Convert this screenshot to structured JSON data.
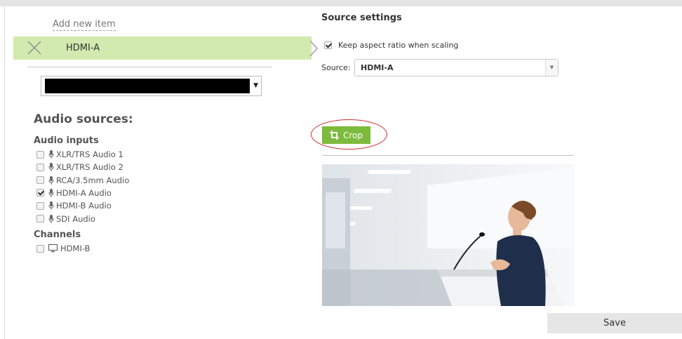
{
  "left": {
    "add_item": "Add new item",
    "selected_item": "HDMI-A",
    "audio_heading": "Audio sources:",
    "audio_inputs_heading": "Audio inputs",
    "audio_inputs": [
      {
        "label": "XLR/TRS Audio 1",
        "checked": false
      },
      {
        "label": "XLR/TRS Audio 2",
        "checked": false
      },
      {
        "label": "RCA/3.5mm Audio",
        "checked": false
      },
      {
        "label": "HDMI-A Audio",
        "checked": true
      },
      {
        "label": "HDMI-B Audio",
        "checked": false
      },
      {
        "label": "SDI Audio",
        "checked": false
      }
    ],
    "channels_heading": "Channels",
    "channels": [
      {
        "label": "HDMI-B",
        "checked": false
      }
    ]
  },
  "right": {
    "title": "Source settings",
    "keep_aspect_label": "Keep aspect ratio when scaling",
    "keep_aspect_checked": true,
    "source_label": "Source:",
    "source_value": "HDMI-A",
    "crop_label": "Crop",
    "save_label": "Save"
  },
  "colors": {
    "selected_row": "#d2eab0",
    "crop_button": "#7cbb3c",
    "annotation_circle": "#cc2d2d"
  }
}
